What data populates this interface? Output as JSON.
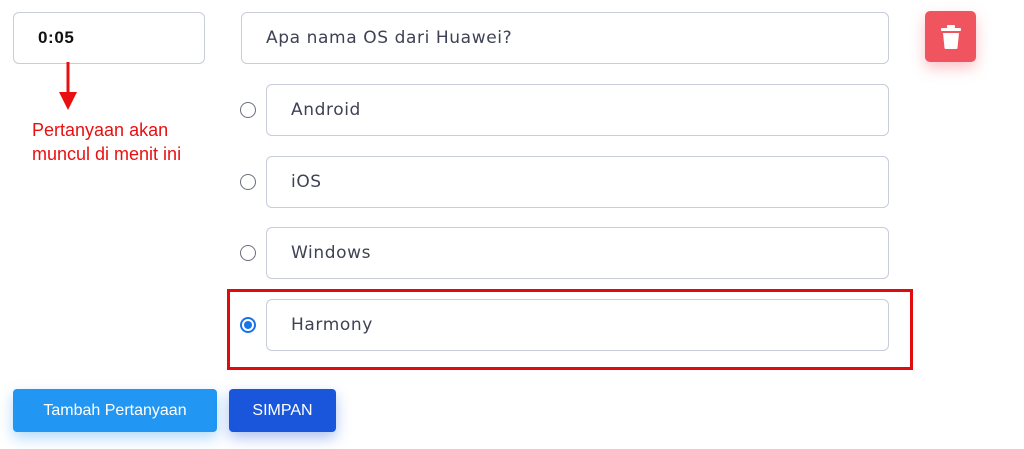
{
  "timestamp": {
    "value": "0:05"
  },
  "annotation": {
    "text_line1": "Pertanyaan akan",
    "text_line2": "muncul di menit ini"
  },
  "question": {
    "value": "Apa nama OS dari Huawei?"
  },
  "options": [
    {
      "label": "Android",
      "selected": false
    },
    {
      "label": "iOS",
      "selected": false
    },
    {
      "label": "Windows",
      "selected": false
    },
    {
      "label": "Harmony",
      "selected": true
    }
  ],
  "actions": {
    "delete_icon": "trash-icon",
    "add_question_label": "Tambah Pertanyaan",
    "save_label": "SIMPAN"
  },
  "colors": {
    "delete": "#f0545f",
    "add": "#2196f3",
    "save": "#1a56db",
    "annotation": "#e81010",
    "radio_checked": "#1a73e8"
  }
}
